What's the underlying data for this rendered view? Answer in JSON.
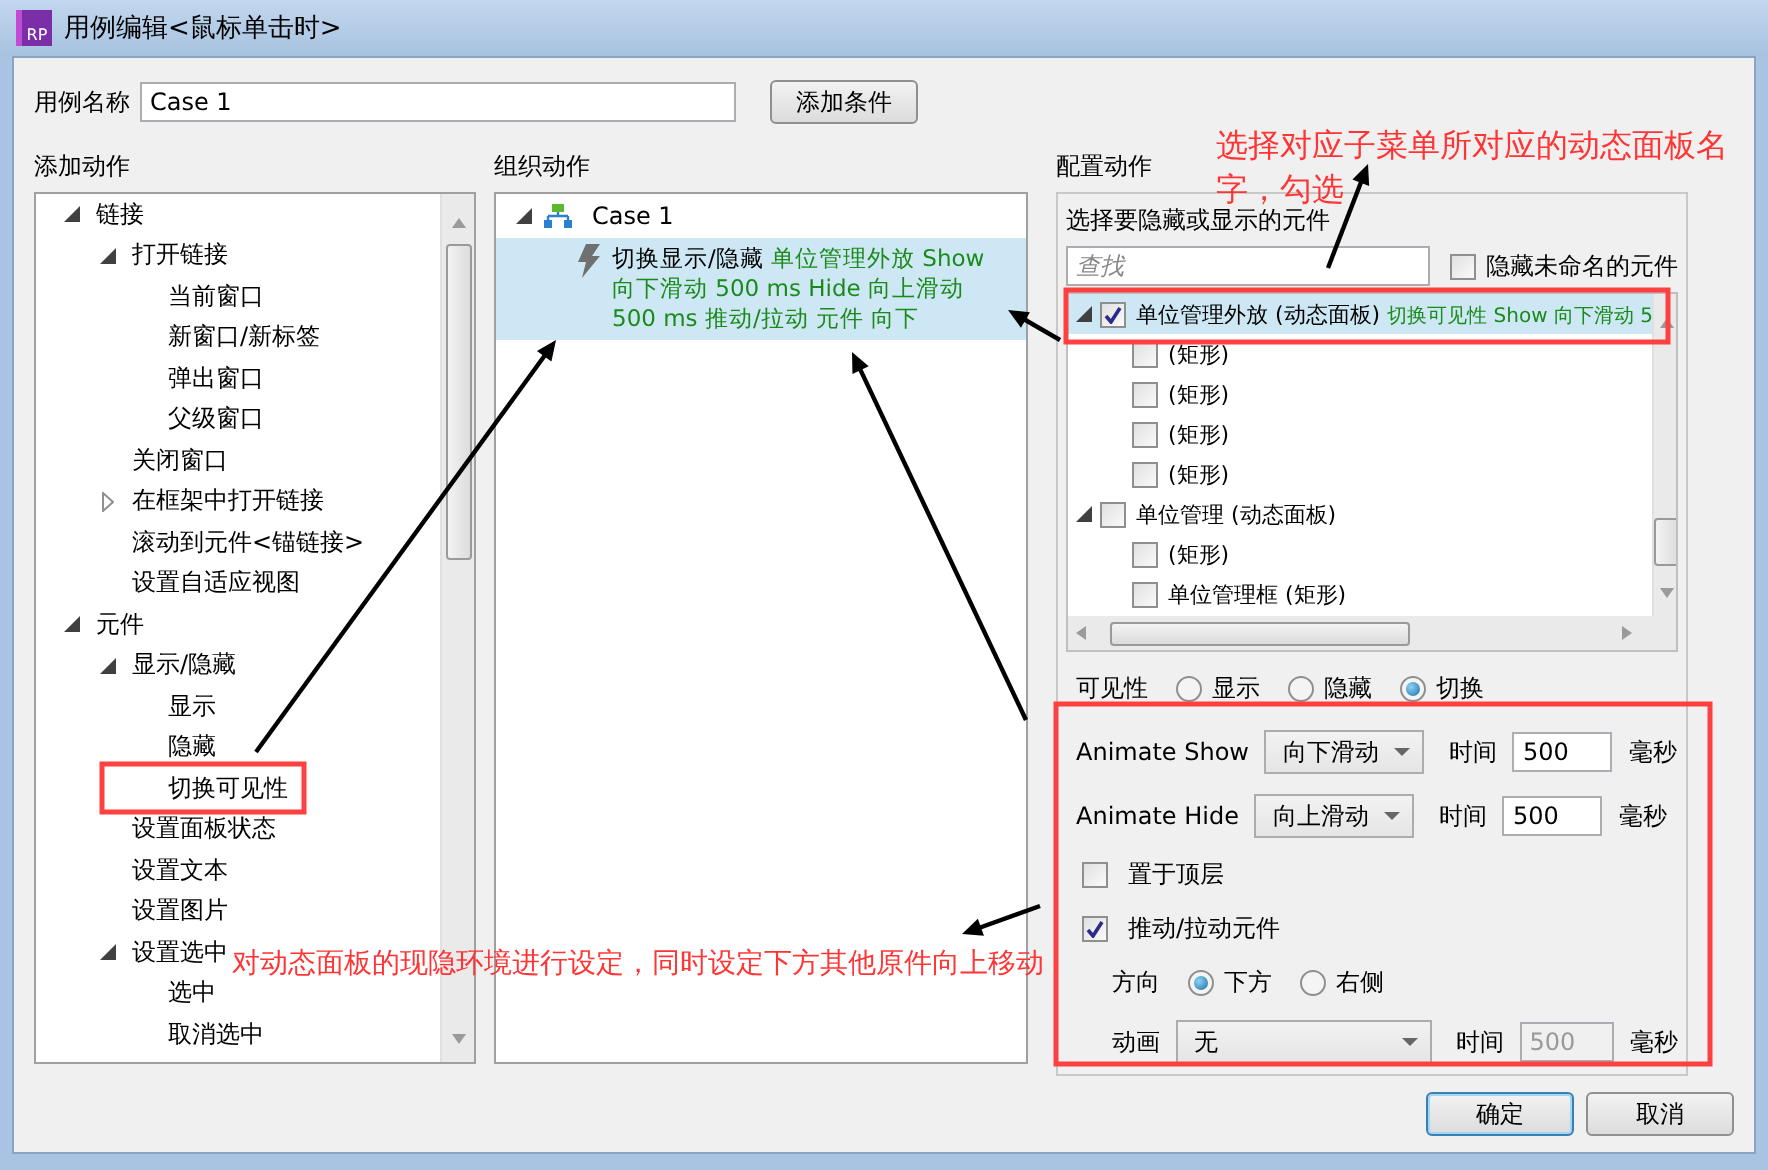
{
  "window": {
    "title": "用例编辑<鼠标单击时>",
    "app_icon": "RP"
  },
  "case_name": {
    "label": "用例名称",
    "value": "Case 1"
  },
  "add_condition_button": "添加条件",
  "add_actions": {
    "title": "添加动作",
    "tree": [
      {
        "label": "链接",
        "expanded": true,
        "children": [
          {
            "label": "打开链接",
            "expanded": true,
            "children": [
              {
                "label": "当前窗口"
              },
              {
                "label": "新窗口/新标签"
              },
              {
                "label": "弹出窗口"
              },
              {
                "label": "父级窗口"
              }
            ]
          },
          {
            "label": "关闭窗口"
          },
          {
            "label": "在框架中打开链接",
            "expanded": false
          },
          {
            "label": "滚动到元件<锚链接>"
          },
          {
            "label": "设置自适应视图"
          }
        ]
      },
      {
        "label": "元件",
        "expanded": true,
        "children": [
          {
            "label": "显示/隐藏",
            "expanded": true,
            "children": [
              {
                "label": "显示"
              },
              {
                "label": "隐藏"
              },
              {
                "label": "切换可见性"
              }
            ]
          },
          {
            "label": "设置面板状态"
          },
          {
            "label": "设置文本"
          },
          {
            "label": "设置图片"
          },
          {
            "label": "设置选中",
            "expanded": true,
            "children": [
              {
                "label": "选中"
              },
              {
                "label": "取消选中"
              }
            ]
          }
        ]
      }
    ]
  },
  "organize_actions": {
    "title": "组织动作",
    "cases": [
      {
        "name": "Case 1",
        "expanded": true,
        "actions": [
          {
            "name": "切换显示/隐藏",
            "detail": "单位管理外放 Show 向下滑动 500 ms Hide 向上滑动 500 ms 推动/拉动 元件 向下",
            "selected": true
          }
        ]
      }
    ]
  },
  "configure_action": {
    "title": "配置动作",
    "widgets_label": "选择要隐藏或显示的元件",
    "search": {
      "placeholder": "查找"
    },
    "hide_unnamed": {
      "label": "隐藏未命名的元件",
      "checked": false
    },
    "widgets": [
      {
        "name": "单位管理外放 (动态面板)",
        "detail": "切换可见性 Show 向下滑动 5",
        "checked": true,
        "selected": true,
        "expanded": true,
        "children": [
          {
            "name": "(矩形)",
            "checked": false,
            "selected": false
          },
          {
            "name": "(矩形)",
            "checked": false,
            "selected": false
          },
          {
            "name": "(矩形)",
            "checked": false,
            "selected": false
          },
          {
            "name": "(矩形)",
            "checked": false,
            "selected": false
          }
        ]
      },
      {
        "name": "单位管理 (动态面板)",
        "checked": false,
        "selected": false,
        "expanded": true,
        "children": [
          {
            "name": "(矩形)",
            "checked": false,
            "selected": false
          },
          {
            "name": "单位管理框 (矩形)",
            "checked": false,
            "selected": false
          }
        ]
      }
    ],
    "visibility": {
      "label": "可见性",
      "options": [
        {
          "label": "显示",
          "selected": false
        },
        {
          "label": "隐藏",
          "selected": false
        },
        {
          "label": "切换",
          "selected": true
        }
      ]
    },
    "animate_show": {
      "label": "Animate Show",
      "value": "向下滑动",
      "time_label": "时间",
      "time": "500",
      "unit": "毫秒"
    },
    "animate_hide": {
      "label": "Animate Hide",
      "value": "向上滑动",
      "time_label": "时间",
      "time": "500",
      "unit": "毫秒"
    },
    "bring_to_front": {
      "label": "置于顶层",
      "checked": false
    },
    "push_widgets": {
      "label": "推动/拉动元件",
      "checked": true
    },
    "direction": {
      "label": "方向",
      "options": [
        {
          "label": "下方",
          "selected": true
        },
        {
          "label": "右侧",
          "selected": false
        }
      ]
    },
    "push_animation": {
      "label": "动画",
      "value": "无",
      "time_label": "时间",
      "time": "500",
      "time_disabled": true,
      "unit": "毫秒"
    }
  },
  "buttons": [
    {
      "label": "确定",
      "default": true
    },
    {
      "label": "取消",
      "default": false
    }
  ],
  "annotations": [
    {
      "text": "选择对应子菜单所对应的动态面板名字，勾选"
    },
    {
      "text": "对动态面板的现隐环境进行设定，同时设定下方其他原件向上移动"
    }
  ]
}
